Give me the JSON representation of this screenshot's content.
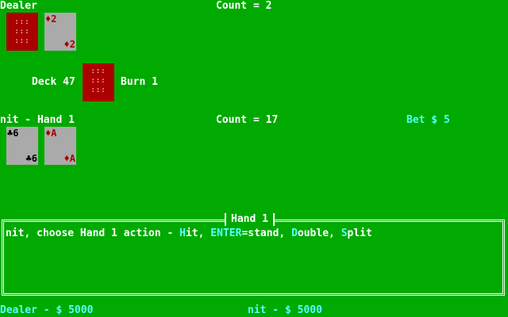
{
  "dealer": {
    "label": "Dealer",
    "count_text": "Count = 2",
    "cards": [
      {
        "facedown": true,
        "pattern": ":::\n:::\n:::"
      },
      {
        "facedown": false,
        "rank_tl": "♦2",
        "rank_br": "♦2",
        "suit_color": "#aa0000"
      }
    ]
  },
  "deck": {
    "label": "Deck 47",
    "burn_label": "Burn 1",
    "pattern": ":::\n:::\n:::"
  },
  "player": {
    "label": "nit - Hand 1",
    "count_text": "Count = 17",
    "bet_text": "Bet $ 5",
    "cards": [
      {
        "facedown": false,
        "rank_tl": "♣6",
        "rank_br": "♣6",
        "suit_color": "#000000"
      },
      {
        "facedown": false,
        "rank_tl": "♦A",
        "rank_br": "♦A",
        "suit_color": "#aa0000"
      }
    ]
  },
  "message_box": {
    "title": "Hand 1",
    "prefix": "nit, choose Hand 1 action - ",
    "actions": [
      {
        "hot": "H",
        "rest": "it",
        "sep": ", "
      },
      {
        "hot": "ENTER",
        "rest": "=stand",
        "sep": ", "
      },
      {
        "hot": "D",
        "rest": "ouble",
        "sep": ", "
      },
      {
        "hot": "S",
        "rest": "plit",
        "sep": ""
      }
    ]
  },
  "status": {
    "dealer_bank": "Dealer - $ 5000",
    "player_bank": "nit - $ 5000"
  },
  "colors": {
    "table": "#00aa00",
    "card_back": "#aa0000",
    "card_face": "#aaaaaa",
    "highlight": "#55ffff"
  }
}
